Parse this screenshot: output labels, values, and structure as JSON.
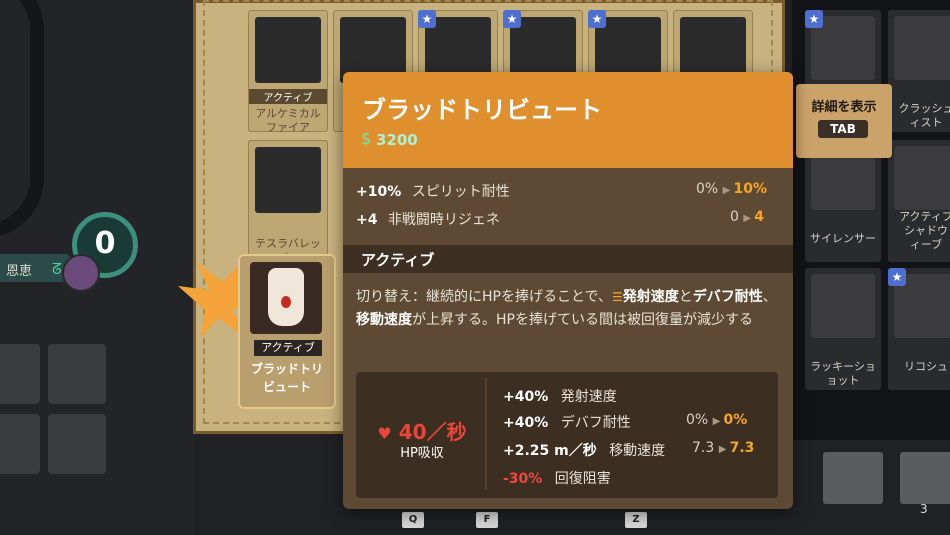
{
  "left_hud": {
    "soul_label": "恩恵",
    "counter": "0"
  },
  "grid": {
    "cells": [
      {
        "tag": "アクティブ",
        "name": "アルケミカル\nファイア"
      },
      {
        "tag": "",
        "name": ""
      },
      {
        "tag": "",
        "name": ""
      },
      {
        "tag": "",
        "name": ""
      },
      {
        "tag": "",
        "name": ""
      },
      {
        "tag": "",
        "name": ""
      },
      {
        "tag": "",
        "name": "テスラバレッ\nト"
      }
    ],
    "star": "★"
  },
  "selected_item": {
    "tag": "アクティブ",
    "name": "ブラッドトリ\nビュート"
  },
  "right_column": [
    {
      "name": ""
    },
    {
      "name": "クラッシュ\nィスト"
    },
    {
      "name": "サイレンサー"
    },
    {
      "name": "アクティブ\nシャドウ\nィーブ"
    },
    {
      "name": "ラッキーショ\nョット"
    },
    {
      "name": "リコシュ"
    }
  ],
  "detail_button": {
    "label": "詳細を表示",
    "key": "TAB"
  },
  "tooltip": {
    "title": "ブラッドトリビュート",
    "price": "3200",
    "stats": [
      {
        "plus": "+10%",
        "name": "スピリット耐性",
        "old": "0%",
        "new": "10%"
      },
      {
        "plus": "+4",
        "name": "非戦闘時リジェネ",
        "old": "0",
        "new": "4"
      }
    ],
    "section": "アクティブ",
    "description": {
      "p1": "切り替え：継続的にHPを捧げることで、",
      "b1": "発射速度",
      "p2": "と",
      "b2": "デバフ耐性",
      "p3": "、",
      "b3": "移動速度",
      "p4": "が上昇する。HPを捧げている間は被回復量が減少する"
    },
    "hp": {
      "value": "40／秒",
      "label": "HP吸収"
    },
    "effects": [
      {
        "plus": "+40%",
        "name": "発射速度",
        "old": "",
        "new": ""
      },
      {
        "plus": "+40%",
        "name": "デバフ耐性",
        "old": "0%",
        "new": "0%"
      },
      {
        "plus": "+2.25 m／秒",
        "name": "移動速度",
        "old": "7.3",
        "new": "7.3"
      },
      {
        "plus": "-30%",
        "name": "回復阻害",
        "old": "",
        "new": ""
      }
    ]
  },
  "bottom_keys": [
    "Q",
    "F",
    "Z",
    "3"
  ],
  "colors": {
    "accent_orange": "#e08f2e",
    "value_orange": "#f5a623",
    "hp_red": "#e8463a",
    "price_teal": "#aef0d2"
  }
}
